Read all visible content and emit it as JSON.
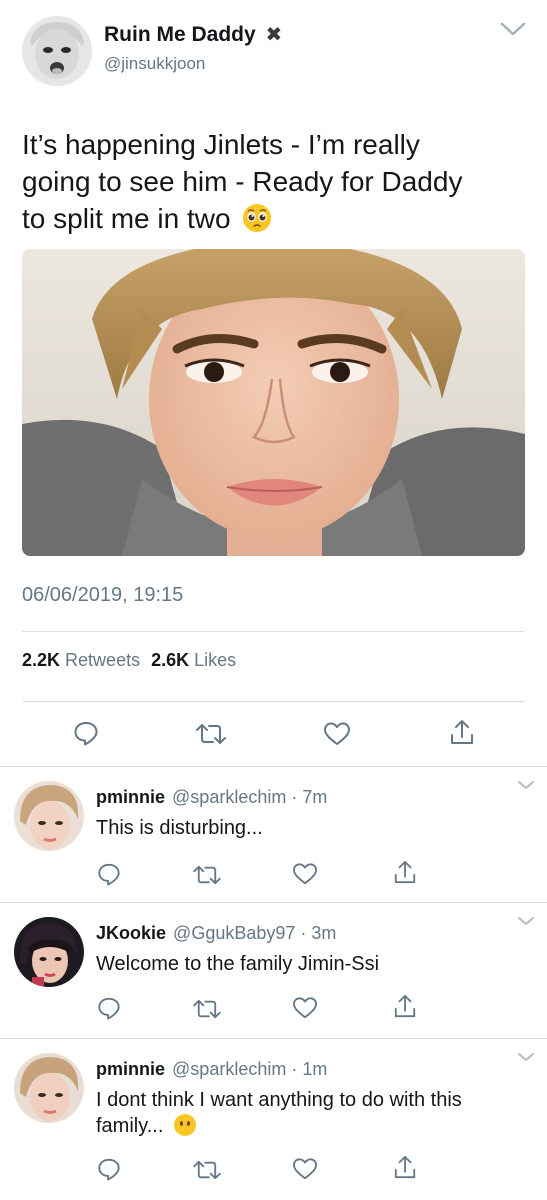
{
  "main_tweet": {
    "display_name": "Ruin Me Daddy",
    "name_emoji": "✖",
    "handle": "@jinsukkjoon",
    "text_line1": "It’s happening Jinlets - I’m really",
    "text_line2": "going to see him - Ready for Daddy",
    "text_line3": "to split me in two",
    "text_emoji": "🥺",
    "timestamp": "06/06/2019, 19:15",
    "retweets_count": "2.2K",
    "retweets_label": "Retweets",
    "likes_count": "2.6K",
    "likes_label": "Likes"
  },
  "replies": [
    {
      "name": "pminnie",
      "handle": "@sparklechim",
      "dot": "·",
      "time": "7m",
      "text_line1": "This is disturbing...",
      "text_line2": ""
    },
    {
      "name": "JKookie",
      "handle": "@GgukBaby97",
      "dot": "·",
      "time": "3m",
      "text_line1": "Welcome to the family Jimin-Ssi",
      "text_line2": ""
    },
    {
      "name": "pminnie",
      "handle": "@sparklechim",
      "dot": "·",
      "time": "1m",
      "text_line1": "I dont think I want anything to do with this",
      "text_line2": "family...",
      "text_emoji": "😶"
    }
  ],
  "colors": {
    "text": "#14171a",
    "muted": "#657786",
    "separator": "#d9dfe3"
  },
  "icons": [
    "reply-icon",
    "retweet-icon",
    "like-icon",
    "share-icon",
    "chevron-down-icon"
  ]
}
